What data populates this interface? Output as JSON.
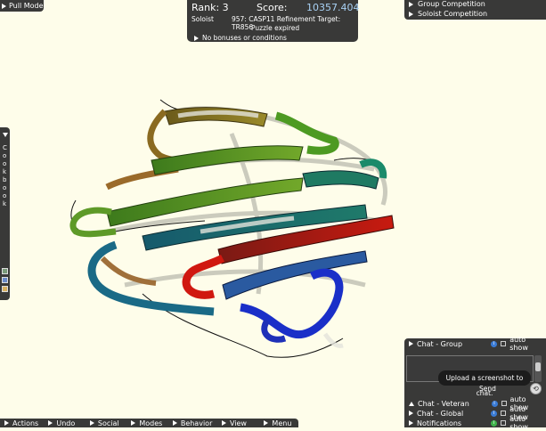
{
  "pull_mode": {
    "label": "Pull Mode"
  },
  "score_panel": {
    "rank_label": "Rank: 3",
    "score_label": "Score:",
    "score_value": "10357.404",
    "mode": "Soloist",
    "puzzle_title": "957: CASP11 Refinement Target: TR856",
    "status": "Puzzle expired",
    "bonuses": "No bonuses or conditions"
  },
  "competitions": [
    "Group Competition",
    "Soloist Competition"
  ],
  "cookbook": {
    "letters": [
      "C",
      "o",
      "o",
      "k",
      "b",
      "o",
      "o",
      "k"
    ]
  },
  "chat": {
    "group": {
      "name": "Chat - Group",
      "toggle": "auto show"
    },
    "veteran": {
      "name": "Chat - Veteran",
      "toggle": "auto show"
    },
    "global": {
      "name": "Chat - Global",
      "toggle": "auto show"
    },
    "notifications": {
      "name": "Notifications",
      "toggle": "auto show"
    },
    "send_label": "Send",
    "tooltip": "Upload a screenshot to chat."
  },
  "bottom_menu": [
    "Actions",
    "Undo",
    "Social",
    "Modes",
    "Behavior",
    "View",
    "Menu"
  ],
  "colors": {
    "background": "#fefdea",
    "panel": "#282828",
    "score_value": "#a9d2f5",
    "strand_olive": "#7a6a1f",
    "strand_green": "#4a8a1e",
    "strand_teal": "#1c5a6a",
    "strand_red": "#b8160f",
    "strand_blue": "#1a2fb0"
  },
  "icons": [
    "triangle-right-icon",
    "triangle-down-icon",
    "info-icon",
    "camera-icon"
  ]
}
